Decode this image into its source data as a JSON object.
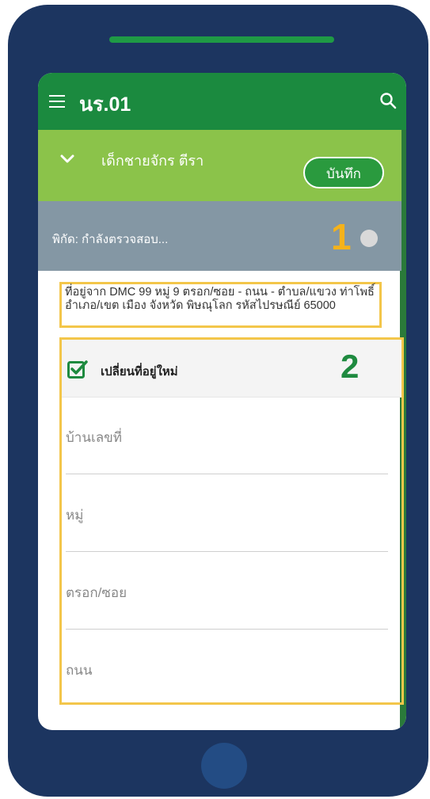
{
  "app": {
    "title": "นร.01"
  },
  "student": {
    "name": "เด็กชายจักร ตีรา",
    "save_label": "บันทึก"
  },
  "location": {
    "status": "พิกัด: กำลังตรวจสอบ...",
    "marker_number": "1"
  },
  "address": {
    "text": "ที่อยู่จาก DMC 99 หมู่ 9 ตรอก/ซอย - ถนน - ตำบล/แขวง ท่าโพธิ์ อำเภอ/เขต เมือง จังหวัด พิษณุโลก รหัสไปรษณีย์ 65000"
  },
  "form": {
    "change_label": "เปลี่ยนที่อยู่ใหม่",
    "change_checked": true,
    "marker_number": "2",
    "fields": [
      {
        "placeholder": "บ้านเลขที่"
      },
      {
        "placeholder": "หมู่"
      },
      {
        "placeholder": "ตรอก/ซอย"
      },
      {
        "placeholder": "ถนน"
      }
    ]
  },
  "colors": {
    "phone_frame": "#1c3560",
    "app_bar": "#1b8a3f",
    "student_bar": "#8bc34a",
    "gps_bar": "#8497a4",
    "highlight_border": "#f3c64a",
    "marker1": "#f5b21a",
    "marker2": "#1e8a3f"
  },
  "icons": {
    "menu": "menu-icon",
    "search": "search-icon",
    "expand": "chevron-down-icon",
    "gps_status": "status-dot-icon",
    "checkbox": "checkbox-checked-icon"
  }
}
